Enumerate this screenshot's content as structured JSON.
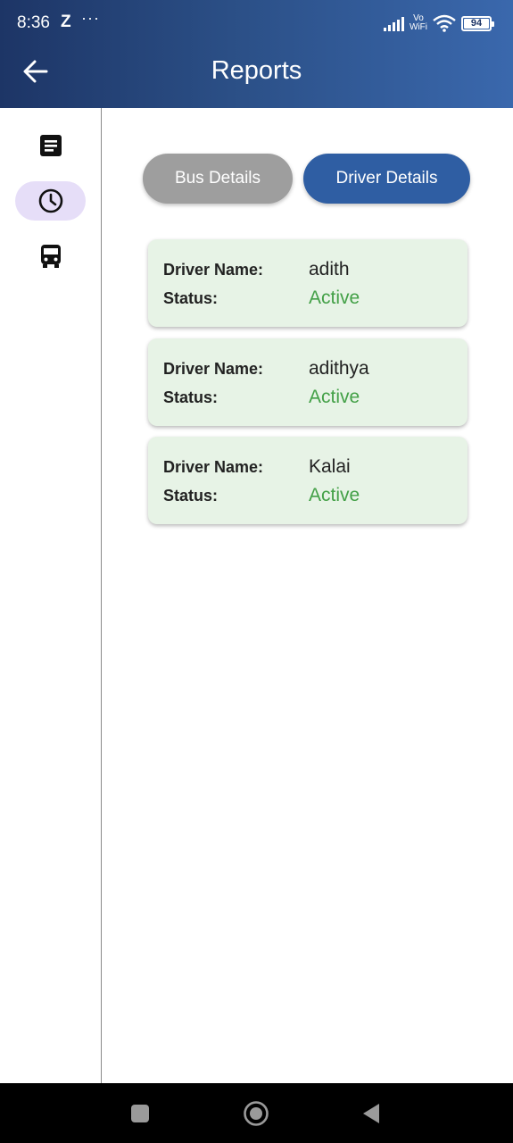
{
  "status_bar": {
    "time": "8:36",
    "z_icon": "Z",
    "overflow": "···",
    "vo_wifi_line1": "Vo",
    "vo_wifi_line2": "WiFi",
    "battery_level": 94,
    "battery_text": "94"
  },
  "header": {
    "title": "Reports",
    "back_icon": "arrow-left-icon"
  },
  "side_rail": {
    "items": [
      {
        "icon": "document-icon",
        "active": false
      },
      {
        "icon": "clock-icon",
        "active": true
      },
      {
        "icon": "bus-icon",
        "active": false
      }
    ]
  },
  "toggle": {
    "bus_label": "Bus Details",
    "driver_label": "Driver Details",
    "selected": "Driver Details"
  },
  "drivers": {
    "name_label": "Driver Name:",
    "status_label": "Status:",
    "status_color": "#43a047",
    "items": [
      {
        "name": "adith",
        "status": "Active"
      },
      {
        "name": "adithya",
        "status": "Active"
      },
      {
        "name": "Kalai",
        "status": "Active"
      }
    ]
  },
  "colors": {
    "header_start": "#1d3566",
    "header_end": "#3a68ad",
    "selected_button": "#2f5ea3",
    "unselected_button": "#9e9e9e",
    "card_bg": "#e7f3e6",
    "rail_active": "#e6def8"
  },
  "nav_bar": {
    "items": [
      "recent-apps-icon",
      "home-icon",
      "back-triangle-icon"
    ]
  }
}
